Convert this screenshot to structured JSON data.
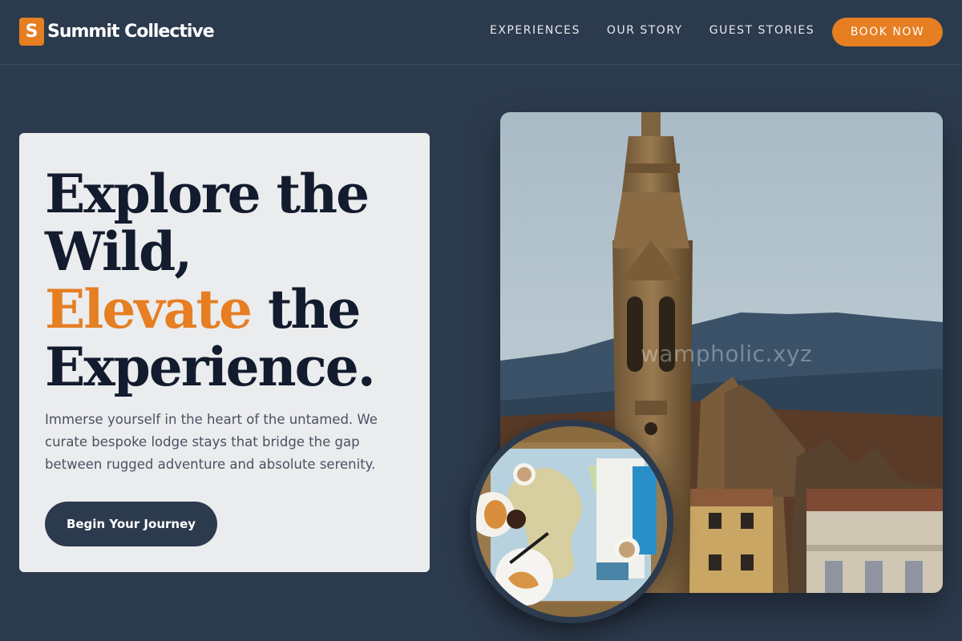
{
  "brand": {
    "mark": "S",
    "name": "Summit Collective"
  },
  "nav": {
    "links": [
      "EXPERIENCES",
      "OUR STORY",
      "GUEST STORIES"
    ],
    "cta": "BOOK NOW"
  },
  "hero": {
    "line1": "Explore the",
    "line2": "Wild,",
    "accent": "Elevate",
    "line3_rest": " the",
    "line4": "Experience.",
    "description": "Immerse yourself in the heart of the untamed. We curate bespoke lodge stays that bridge the gap between rugged adventure and absolute serenity.",
    "cta": "Begin Your Journey"
  },
  "photo": {
    "watermark": "wampholic.xyz"
  },
  "colors": {
    "accent": "#e67e22",
    "background": "#2c3a4d",
    "card": "#ebecee",
    "heading": "#131c2e"
  }
}
